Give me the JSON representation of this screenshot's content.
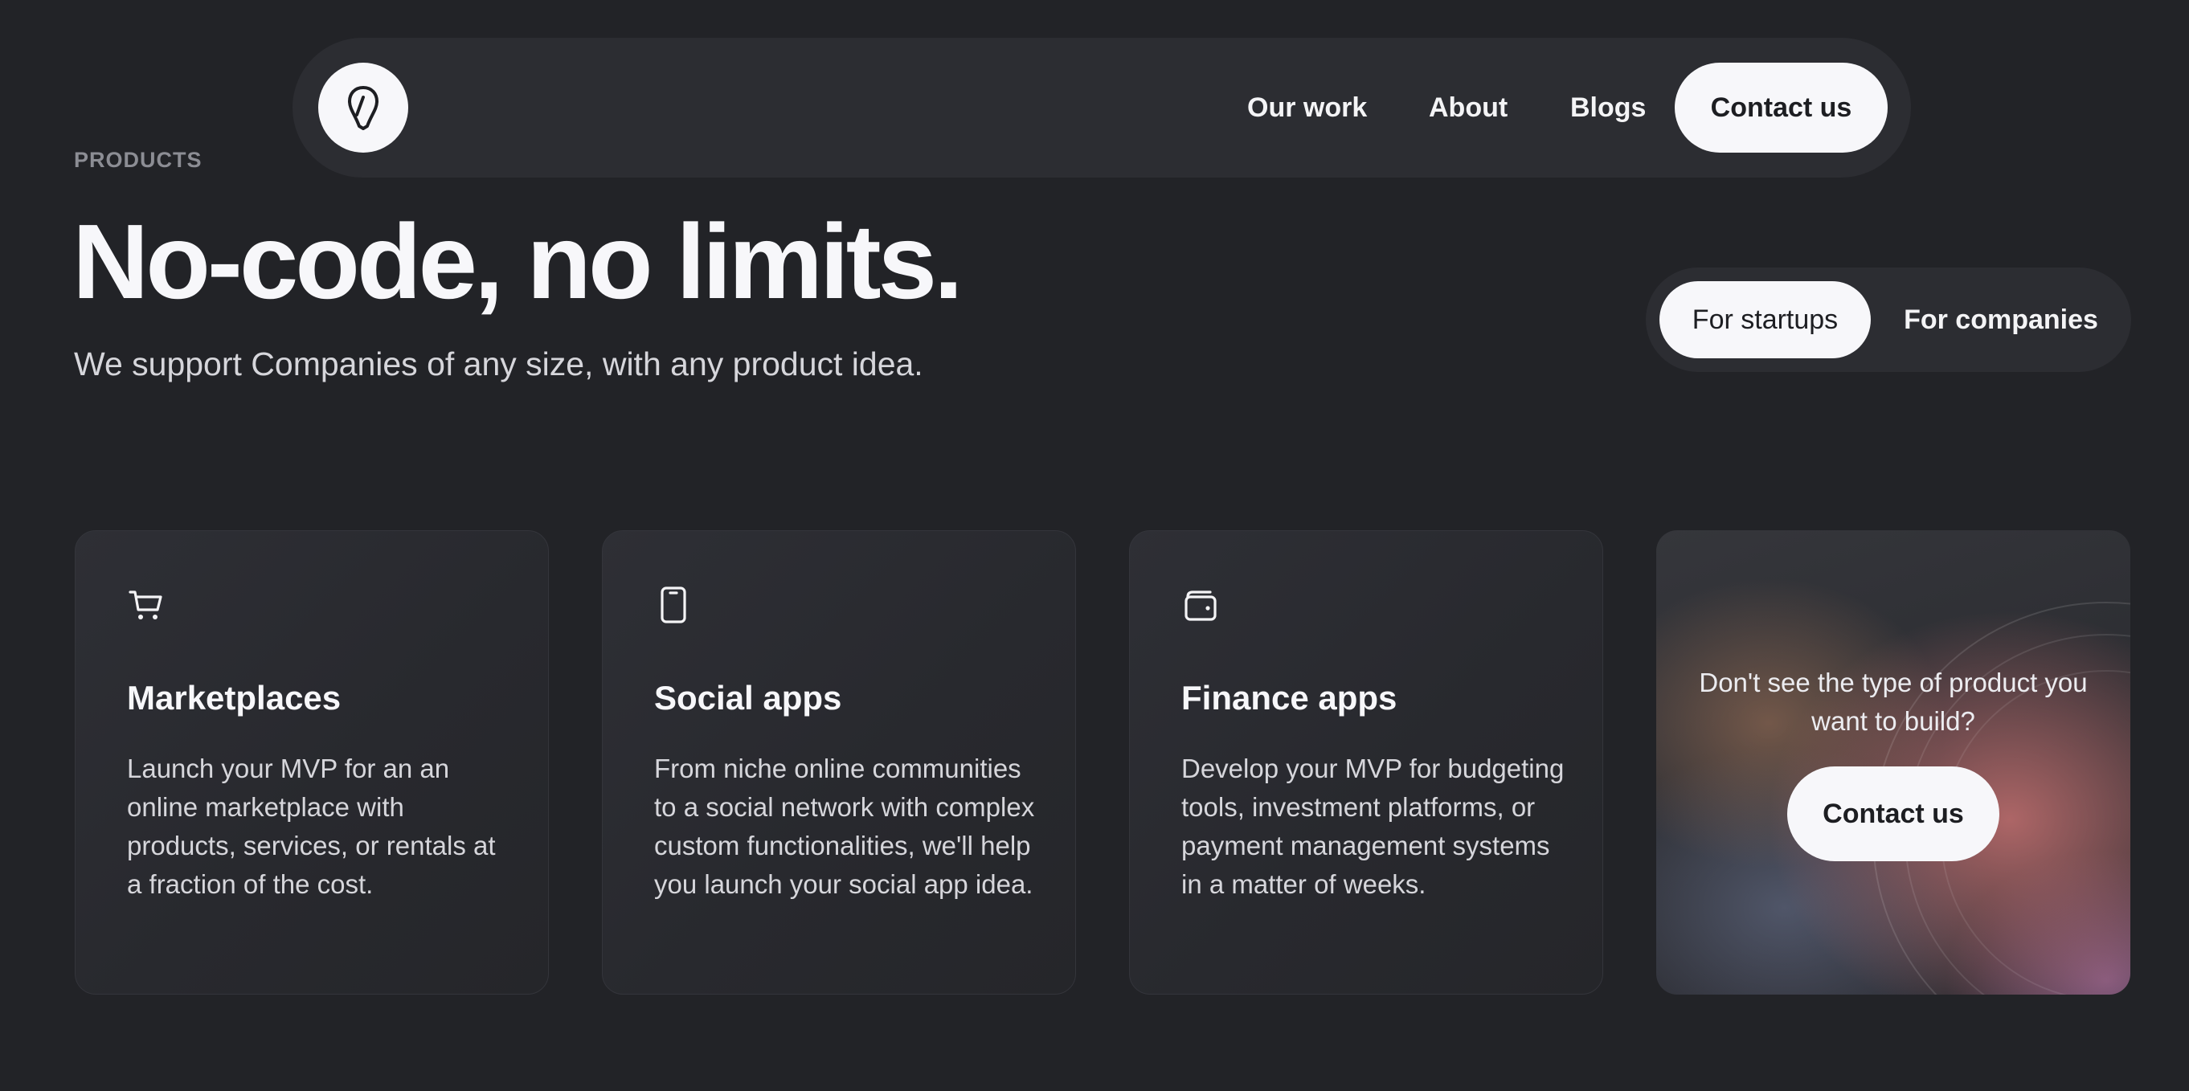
{
  "nav": {
    "links": [
      "Our work",
      "About",
      "Blogs"
    ],
    "cta_label": "Contact us",
    "logo_icon": "location-pin-icon"
  },
  "hero": {
    "eyebrow": "PRODUCTS",
    "title": "No-code, no limits.",
    "subtitle": "We support Companies of any size, with any product idea."
  },
  "audience_toggle": {
    "options": [
      "For startups",
      "For companies"
    ],
    "selected": "For startups"
  },
  "cards": [
    {
      "icon": "shopping-cart-icon",
      "title": "Marketplaces",
      "body": "Launch your MVP for an an online marketplace with products, services, or rentals at a fraction of the cost."
    },
    {
      "icon": "smartphone-icon",
      "title": "Social apps",
      "body": "From niche online communities to a social network with complex custom functionalities, we'll help you launch your social app idea."
    },
    {
      "icon": "wallet-icon",
      "title": "Finance apps",
      "body": "Develop your MVP for budgeting tools, investment platforms, or payment management systems in a matter of weeks."
    }
  ],
  "cta_card": {
    "text": "Don't see the type of product you want to build?",
    "button_label": "Contact us"
  },
  "colors": {
    "background": "#222327",
    "surface": "#2c2d32",
    "light": "#f7f7fa",
    "accent_glow": "#c47070"
  }
}
